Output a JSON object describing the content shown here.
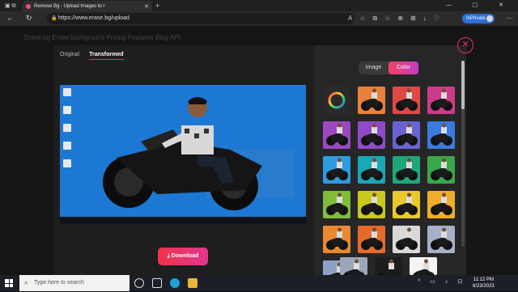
{
  "browser": {
    "tab_title": "Remove Bg - Upload Images to r",
    "tab_close": "✕",
    "new_tab": "+",
    "url": "https://www.erase.bg/upload",
    "inprivate_label": "InPrivate",
    "window_controls": "—  ▢  ✕"
  },
  "page": {
    "background_nav": "Erase.bg        Erase.background      Pricing      Features      Blog      API"
  },
  "editor": {
    "tabs": [
      {
        "label": "Original"
      },
      {
        "label": "Transformed"
      }
    ],
    "toggle": {
      "image": "Image",
      "color": "Color"
    },
    "download_label": "Download",
    "close_icon": "✕"
  },
  "swatches": [
    "#e8823a",
    "#e04848",
    "#cc3a8a",
    "#9c48c0",
    "#8f4ac8",
    "#6a62d4",
    "#3a7be0",
    "#2e9be0",
    "#1aa7b6",
    "#1fa67a",
    "#39a84a",
    "#7fbc3c",
    "#c8c81e",
    "#e8c82a",
    "#f0ad2c",
    "#ea8a2e",
    "#e66a2a",
    "#d8d8d8",
    "#a8b0c8",
    "#8ca0c8"
  ],
  "bottom_thumbs": [
    "#9ca6b8",
    "#1d1d1d",
    "#f4f4f4"
  ],
  "taskbar": {
    "search_placeholder": "Type here to search",
    "time": "11:12 PM",
    "date": "6/23/2023"
  }
}
